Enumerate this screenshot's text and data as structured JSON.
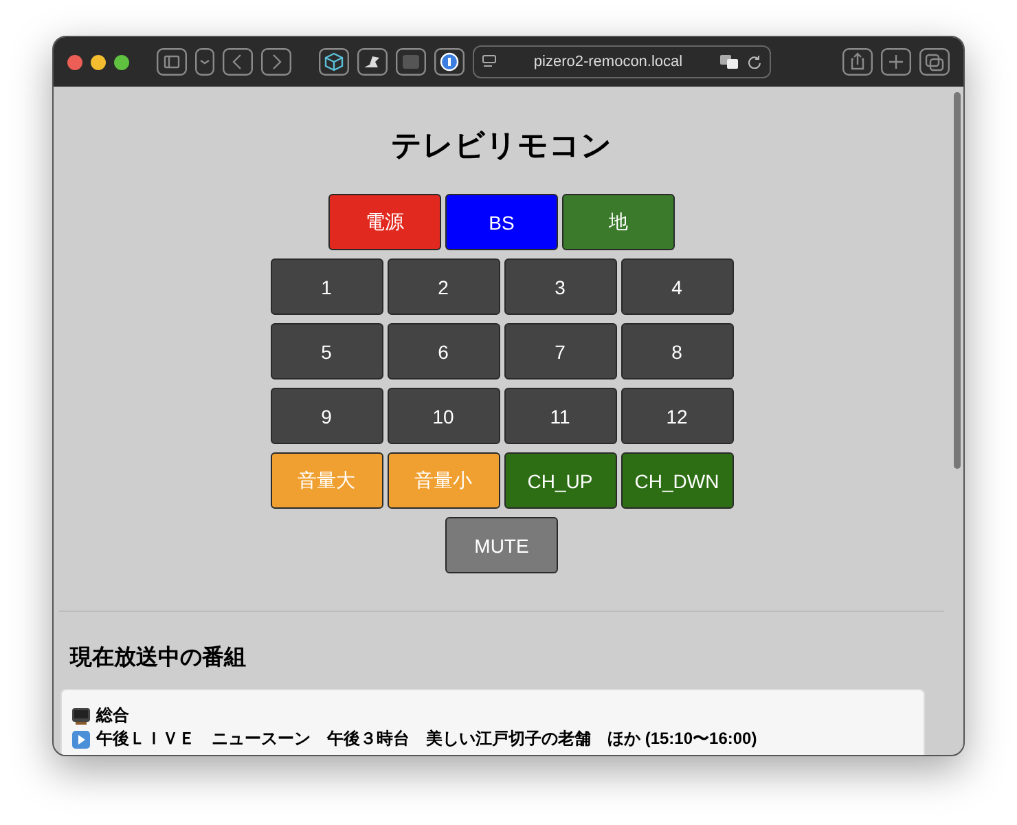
{
  "browser": {
    "url": "pizero2-remocon.local"
  },
  "page": {
    "title": "テレビリモコン",
    "button_rows": [
      [
        {
          "label": "電源",
          "color": "#e2291f"
        },
        {
          "label": "BS",
          "color": "#0000ff"
        },
        {
          "label": "地",
          "color": "#3a7a2a"
        }
      ],
      [
        {
          "label": "1",
          "color": "#444444"
        },
        {
          "label": "2",
          "color": "#444444"
        },
        {
          "label": "3",
          "color": "#444444"
        },
        {
          "label": "4",
          "color": "#444444"
        }
      ],
      [
        {
          "label": "5",
          "color": "#444444"
        },
        {
          "label": "6",
          "color": "#444444"
        },
        {
          "label": "7",
          "color": "#444444"
        },
        {
          "label": "8",
          "color": "#444444"
        }
      ],
      [
        {
          "label": "9",
          "color": "#444444"
        },
        {
          "label": "10",
          "color": "#444444"
        },
        {
          "label": "11",
          "color": "#444444"
        },
        {
          "label": "12",
          "color": "#444444"
        }
      ],
      [
        {
          "label": "音量大",
          "color": "#f0a030"
        },
        {
          "label": "音量小",
          "color": "#f0a030"
        },
        {
          "label": "CH_UP",
          "color": "#2d6e14"
        },
        {
          "label": "CH_DWN",
          "color": "#2d6e14"
        }
      ],
      [
        {
          "label": "MUTE",
          "color": "#7a7a7a"
        }
      ]
    ],
    "section_title": "現在放送中の番組",
    "programs": [
      {
        "channel": "総合",
        "program": "午後ＬＩＶＥ　ニュースーン　午後３時台　美しい江戸切子の老舗　ほか (15:10〜16:00)"
      }
    ]
  }
}
